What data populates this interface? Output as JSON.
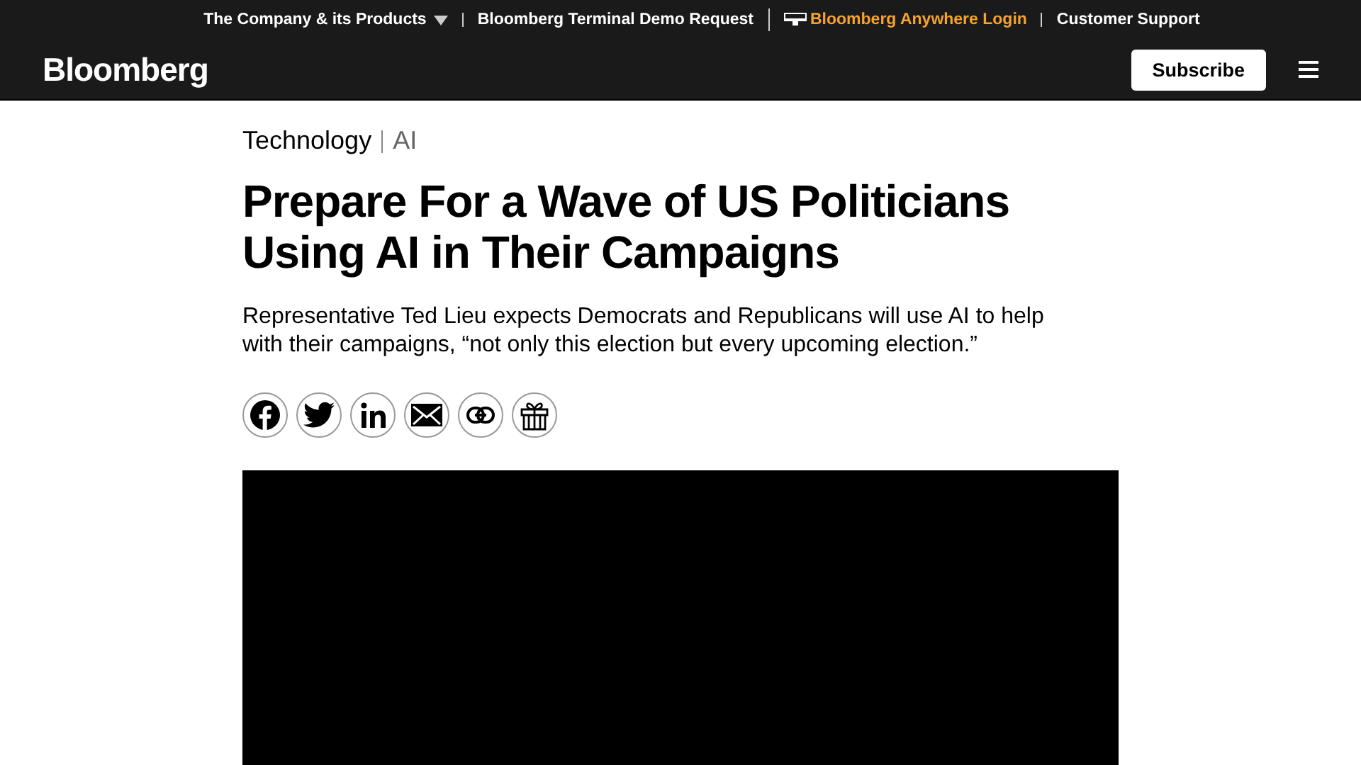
{
  "top_bar": {
    "links": [
      {
        "label": "The Company & its Products",
        "kind": "dropdown"
      },
      {
        "label": "Bloomberg Terminal Demo Request",
        "kind": "link"
      },
      {
        "label": "Bloomberg Anywhere Login",
        "kind": "highlight"
      },
      {
        "label": "Customer Support",
        "kind": "link"
      }
    ]
  },
  "header": {
    "logo": "Bloomberg",
    "subscribe": "Subscribe"
  },
  "article": {
    "category": "Technology",
    "subcategory": "AI",
    "headline": "Prepare For a Wave of US Politicians Using AI in Their Campaigns",
    "summary": "Representative Ted Lieu expects Democrats and Republicans will use AI to help with their campaigns, “not only this election but every upcoming election.”",
    "share_buttons": [
      {
        "kind": "facebook"
      },
      {
        "kind": "twitter"
      },
      {
        "kind": "linkedin"
      },
      {
        "kind": "email"
      },
      {
        "kind": "link"
      },
      {
        "kind": "gift"
      }
    ]
  }
}
